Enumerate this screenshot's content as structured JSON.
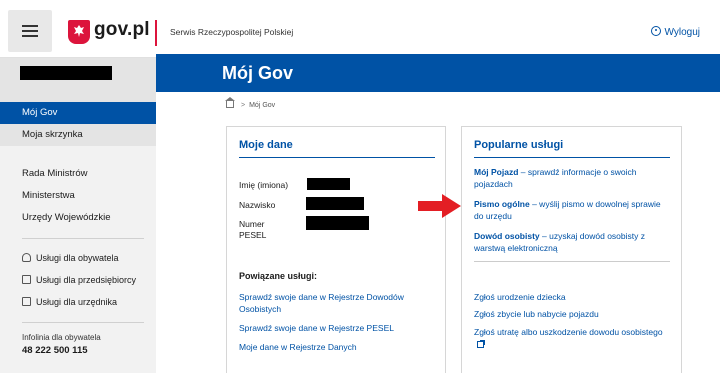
{
  "header": {
    "logo_text": "gov.pl",
    "service_name": "Serwis Rzeczypospolitej Polskiej",
    "logout_label": "Wyloguj"
  },
  "sidebar": {
    "items": [
      {
        "label": "Mój Gov"
      },
      {
        "label": "Moja skrzynka"
      },
      {
        "label": "Rada Ministrów"
      },
      {
        "label": "Ministerstwa"
      },
      {
        "label": "Urzędy Wojewódzkie"
      }
    ],
    "service_links": [
      {
        "label": "Usługi dla obywatela",
        "icon": "person-icon"
      },
      {
        "label": "Usługi dla przedsiębiorcy",
        "icon": "briefcase-icon"
      },
      {
        "label": "Usługi dla urzędnika",
        "icon": "building-icon"
      }
    ],
    "infoline_label": "Infolinia dla obywatela",
    "infoline_number": "48 222 500 115"
  },
  "banner": {
    "title": "Mój Gov"
  },
  "breadcrumb": {
    "current": "Mój Gov"
  },
  "my_data": {
    "title": "Moje dane",
    "fields": [
      {
        "label": "Imię (imiona)"
      },
      {
        "label": "Nazwisko"
      },
      {
        "label": "Numer PESEL"
      }
    ],
    "related_title": "Powiązane usługi:",
    "related_links": [
      {
        "label": "Sprawdź swoje dane w Rejestrze Dowodów Osobistych"
      },
      {
        "label": "Sprawdź swoje dane w Rejestrze PESEL"
      },
      {
        "label": "Moje dane w Rejestrze Danych"
      }
    ]
  },
  "popular": {
    "title": "Popularne usługi",
    "featured": [
      {
        "name": "Mój Pojazd",
        "desc": " – sprawdź informacje o swoich pojazdach"
      },
      {
        "name": "Pismo ogólne",
        "desc": " – wyślij pismo w dowolnej sprawie do urzędu"
      },
      {
        "name": "Dowód osobisty",
        "desc": " – uzyskaj dowód osobisty z warstwą elektroniczną"
      }
    ],
    "links": [
      {
        "label": "Zgłoś urodzenie dziecka"
      },
      {
        "label": "Zgłoś zbycie lub nabycie pojazdu"
      },
      {
        "label": "Zgłoś utratę albo uszkodzenie dowodu osobistego"
      }
    ]
  },
  "colors": {
    "brand_blue": "#0052a5",
    "brand_red": "#dc143c",
    "annotation_arrow": "#e31e24"
  }
}
